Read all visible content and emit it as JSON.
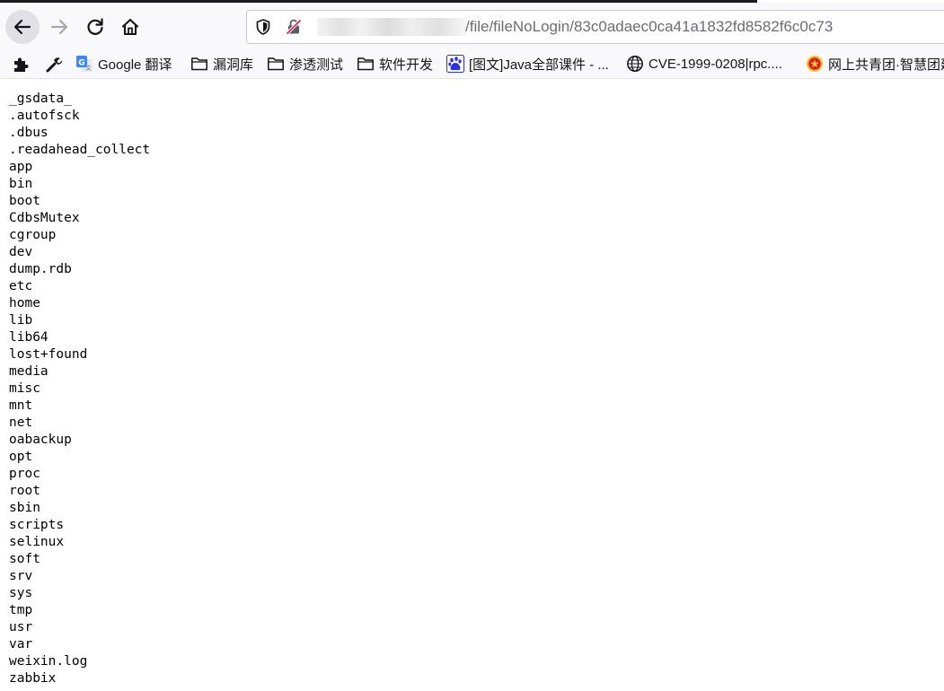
{
  "browser": {
    "address_bar": {
      "url_path": "/file/fileNoLogin/83c0adaec0ca41a1832fd8582f6c0c73"
    },
    "bookmarks": [
      {
        "label": "Google 翻译",
        "icon": "google-translate-icon"
      },
      {
        "label": "漏洞库",
        "icon": "folder-icon"
      },
      {
        "label": "渗透测试",
        "icon": "folder-icon"
      },
      {
        "label": "软件开发",
        "icon": "folder-icon"
      },
      {
        "label": "[图文]Java全部课件 - ...",
        "icon": "baidu-paw-icon"
      },
      {
        "label": "CVE-1999-0208|rpc....",
        "icon": "globe-icon"
      },
      {
        "label": "网上共青团·智慧团建",
        "icon": "youth-league-emblem-icon"
      }
    ]
  },
  "page": {
    "entries": [
      "_gsdata_",
      ".autofsck",
      ".dbus",
      ".readahead_collect",
      "app",
      "bin",
      "boot",
      "CdbsMutex",
      "cgroup",
      "dev",
      "dump.rdb",
      "etc",
      "home",
      "lib",
      "lib64",
      "lost+found",
      "media",
      "misc",
      "mnt",
      "net",
      "oabackup",
      "opt",
      "proc",
      "root",
      "sbin",
      "scripts",
      "selinux",
      "soft",
      "srv",
      "sys",
      "tmp",
      "usr",
      "var",
      "weixin.log",
      "zabbix"
    ]
  },
  "colors": {
    "toolbar_bg": "#f9f9fb",
    "page_bg": "#ffffff",
    "url_text": "#6d6d72",
    "baidu_blue": "#2932e1",
    "league_red": "#d8211d"
  }
}
